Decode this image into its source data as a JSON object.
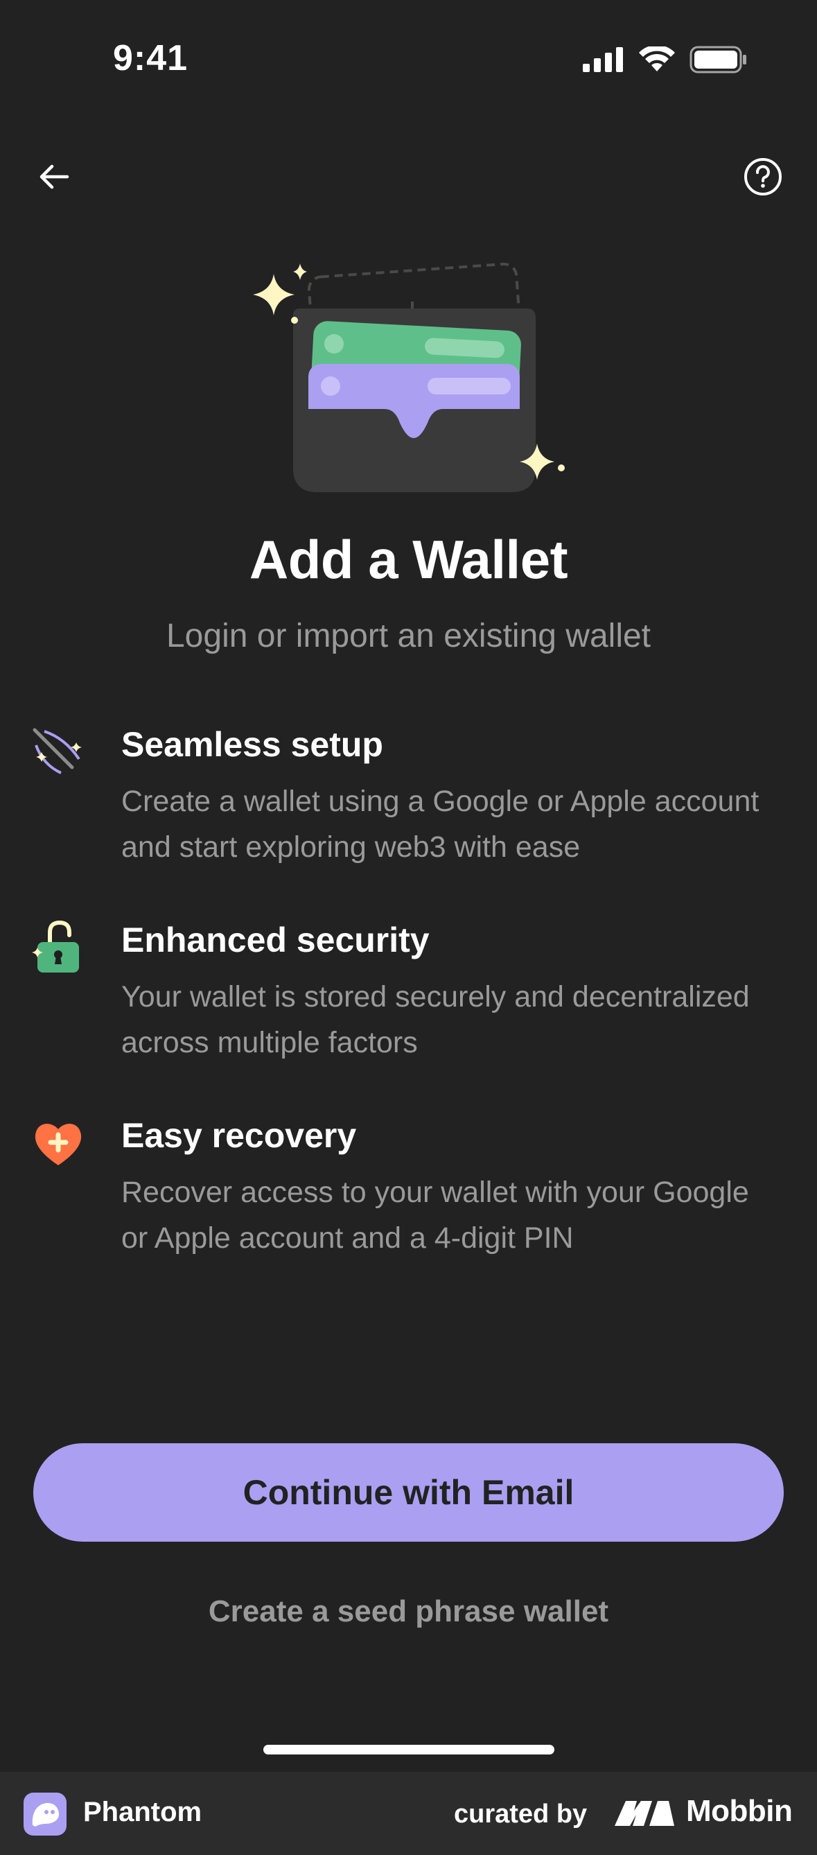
{
  "status_bar": {
    "time": "9:41"
  },
  "header": {
    "back_icon": "arrow-left-icon",
    "help_icon": "question-circle-icon"
  },
  "hero": {
    "illustration": "wallet-cards-illustration"
  },
  "title": "Add a Wallet",
  "subtitle": "Login or import an existing wallet",
  "features": [
    {
      "icon": "wand-sparkle-icon",
      "title": "Seamless setup",
      "description": "Create a wallet using a Google or Apple account and start exploring web3 with ease"
    },
    {
      "icon": "unlocked-padlock-icon",
      "title": "Enhanced security",
      "description": "Your wallet is stored securely and decentralized across multiple factors"
    },
    {
      "icon": "heart-plus-icon",
      "title": "Easy recovery",
      "description": "Recover access to your wallet with your Google or Apple account and a 4-digit PIN"
    }
  ],
  "actions": {
    "primary_label": "Continue with Email",
    "secondary_label": "Create a seed phrase wallet"
  },
  "footer": {
    "app_name": "Phantom",
    "curated_by": "curated by",
    "brand": "Mobbin"
  },
  "colors": {
    "background": "#222222",
    "accent": "#ab9ff2",
    "muted_text": "#9a9a9a",
    "green_card": "#5fbf8a",
    "heart": "#ff7243"
  }
}
